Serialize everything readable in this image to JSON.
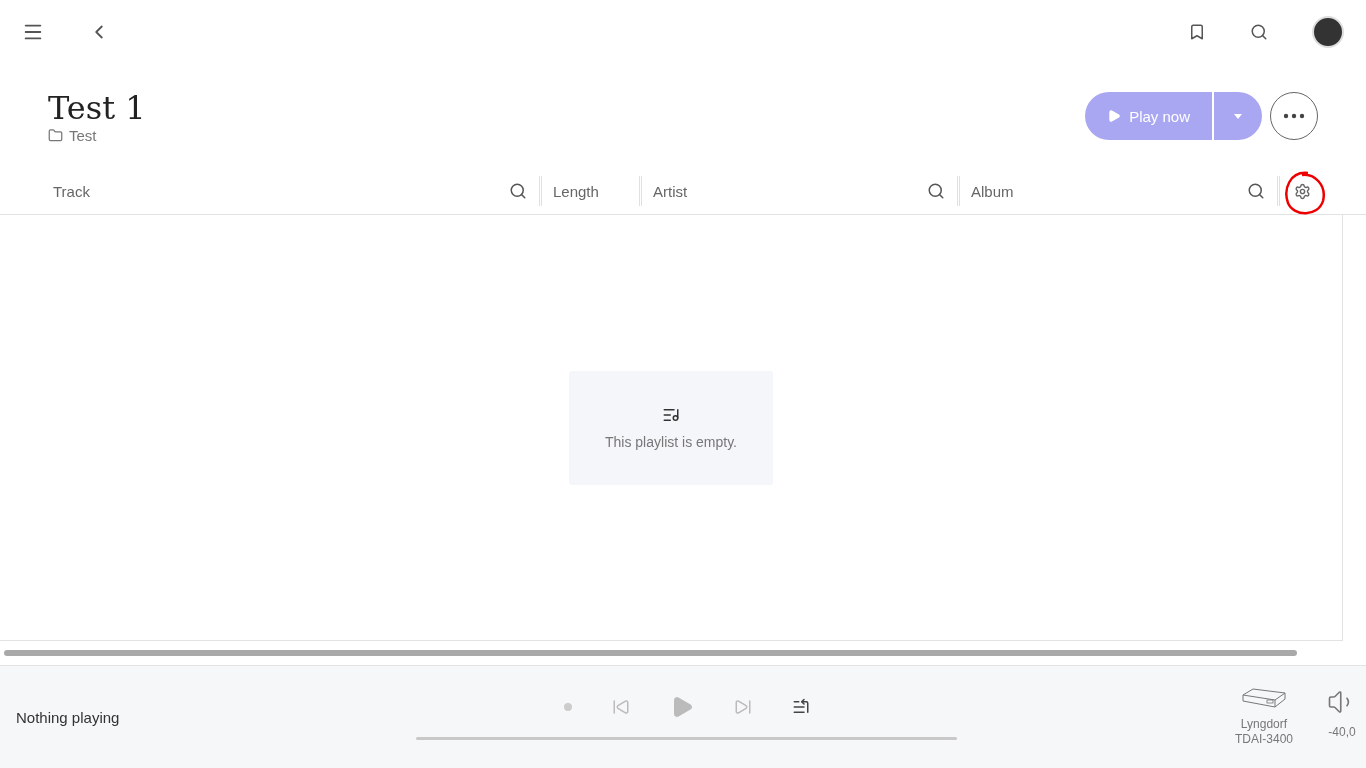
{
  "playlist": {
    "title": "Test 1",
    "folder": "Test"
  },
  "play_button": {
    "label": "Play now",
    "disabled": true
  },
  "columns": [
    {
      "label": "Track",
      "searchable": true
    },
    {
      "label": "Length",
      "searchable": false
    },
    {
      "label": "Artist",
      "searchable": true
    },
    {
      "label": "Album",
      "searchable": true
    }
  ],
  "empty_message": "This playlist is empty.",
  "player": {
    "status": "Nothing playing",
    "level": 0,
    "zone": "Lyngdorf\nTDAI-3400",
    "volume": "-40,0"
  }
}
